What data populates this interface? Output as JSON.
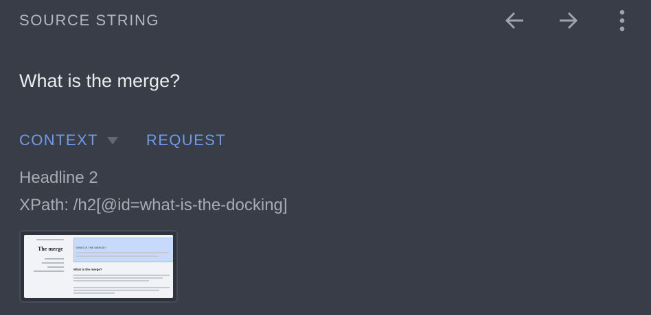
{
  "header": {
    "title": "SOURCE STRING",
    "prev_icon": "arrow-left-icon",
    "next_icon": "arrow-right-icon",
    "more_icon": "more-vertical-icon"
  },
  "source": {
    "text": "What is the merge?"
  },
  "tabs": [
    {
      "label": "CONTEXT",
      "icon": "caret-down-icon"
    },
    {
      "label": "REQUEST"
    }
  ],
  "context": {
    "line1": "Headline 2",
    "line2": "XPath: /h2[@id=what-is-the-docking]"
  },
  "screenshot": {
    "title": "The merge",
    "highlight_text": "WHAT IS THE MERGE?",
    "subheading": "What is the merge?"
  },
  "colors": {
    "background": "#383d47",
    "accent": "#6f9be8",
    "primary_text": "#e9ebee",
    "secondary_text": "#a7abb3"
  }
}
